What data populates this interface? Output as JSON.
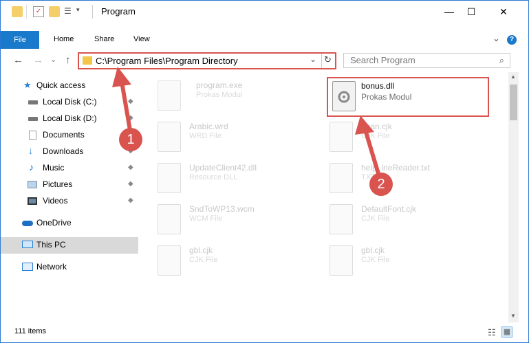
{
  "window": {
    "title": "Program",
    "minimize": "—",
    "maximize": "☐",
    "close": "✕"
  },
  "ribbon": {
    "tabs": [
      "File",
      "Home",
      "Share",
      "View"
    ],
    "expand": "⌄",
    "help": "?"
  },
  "nav": {
    "back": "←",
    "forward": "→",
    "recent": "⌄",
    "up": "↑"
  },
  "address": {
    "path": "C:\\Program Files\\Program Directory",
    "dropdown": "⌄",
    "refresh": "↻"
  },
  "search": {
    "placeholder": "Search Program",
    "icon": "⌕"
  },
  "sidebar": {
    "items": [
      {
        "label": "Quick access",
        "icon": "star-icon",
        "pinned": false
      },
      {
        "label": "Local Disk (C:)",
        "icon": "drive-icon",
        "pinned": true
      },
      {
        "label": "Local Disk (D:)",
        "icon": "drive-icon",
        "pinned": true
      },
      {
        "label": "Documents",
        "icon": "documents-icon",
        "pinned": true
      },
      {
        "label": "Downloads",
        "icon": "download-icon",
        "pinned": true
      },
      {
        "label": "Music",
        "icon": "music-icon",
        "pinned": true
      },
      {
        "label": "Pictures",
        "icon": "pictures-icon",
        "pinned": true
      },
      {
        "label": "Videos",
        "icon": "videos-icon",
        "pinned": true
      },
      {
        "label": "OneDrive",
        "icon": "cloud-icon",
        "pinned": false
      },
      {
        "label": "This PC",
        "icon": "pc-icon",
        "pinned": false,
        "selected": true
      },
      {
        "label": "Network",
        "icon": "network-icon",
        "pinned": false
      }
    ],
    "pin_glyph": "📌"
  },
  "files": [
    {
      "name": "program.exe",
      "type": "Prokas Modul"
    },
    {
      "name": "Arabic.wrd",
      "type": "WRD File"
    },
    {
      "name": "hean.cjk",
      "type": "CJK File"
    },
    {
      "name": "UpdateClient42.dll",
      "type": "Resource DLL"
    },
    {
      "name": "helpLineReader.txt",
      "type": "TXT"
    },
    {
      "name": "SndToWP13.wcm",
      "type": "WCM File"
    },
    {
      "name": "DefaultFont.cjk",
      "type": "CJK File"
    },
    {
      "name": "gbl.cjk",
      "type": "CJK File"
    },
    {
      "name": "gbl.cjk",
      "type": "CJK File"
    }
  ],
  "highlighted_file": {
    "name": "bonus.dll",
    "type": "Prokas Modul"
  },
  "status": {
    "count": "111 items"
  },
  "annotations": {
    "step1": "1",
    "step2": "2"
  },
  "colors": {
    "accent": "#1979ca",
    "highlight": "#d9534f"
  }
}
